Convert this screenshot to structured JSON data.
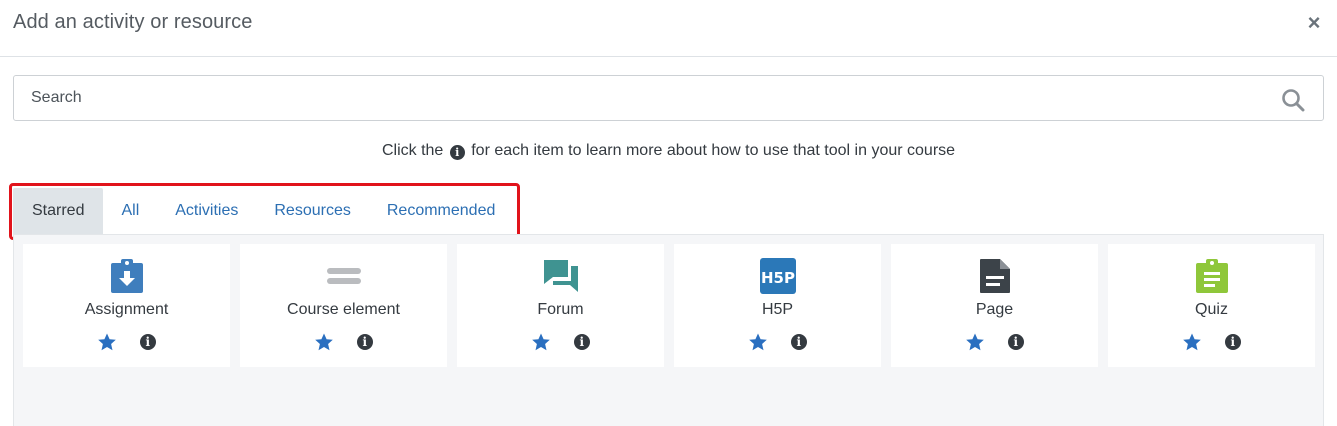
{
  "modal": {
    "title": "Add an activity or resource",
    "close_label": "×"
  },
  "search": {
    "placeholder": "Search",
    "value": ""
  },
  "help": {
    "prefix": "Click the",
    "info_glyph": "i",
    "suffix": "for each item to learn more about how to use that tool in your course"
  },
  "tabs": [
    {
      "label": "Starred",
      "active": true
    },
    {
      "label": "All",
      "active": false
    },
    {
      "label": "Activities",
      "active": false
    },
    {
      "label": "Resources",
      "active": false
    },
    {
      "label": "Recommended",
      "active": false
    }
  ],
  "cards": [
    {
      "label": "Assignment",
      "icon": "assignment-icon",
      "color": "#3f7ebd",
      "starred": true
    },
    {
      "label": "Course element",
      "icon": "course-element-icon",
      "color": "#babcbf",
      "starred": true
    },
    {
      "label": "Forum",
      "icon": "forum-icon",
      "color": "#3f9391",
      "starred": true
    },
    {
      "label": "H5P",
      "icon": "h5p-icon",
      "color": "#2b78b8",
      "starred": true
    },
    {
      "label": "Page",
      "icon": "page-icon",
      "color": "#3c4349",
      "starred": true
    },
    {
      "label": "Quiz",
      "icon": "quiz-icon",
      "color": "#8fc73a",
      "starred": true
    }
  ],
  "colors": {
    "accent": "#2c6fb3",
    "star": "#2a6fc0",
    "highlight": "#e1131b",
    "active_tab_bg": "#dfe4e8"
  }
}
